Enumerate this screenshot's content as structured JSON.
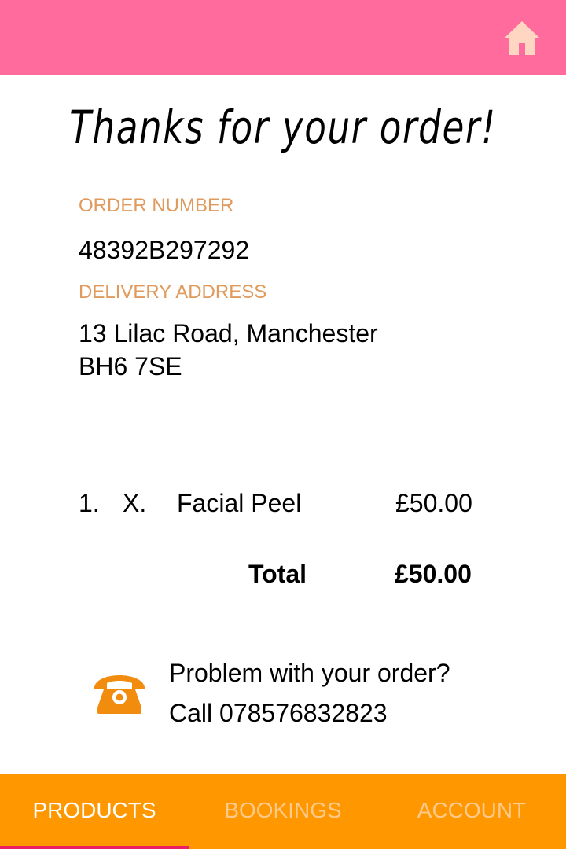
{
  "colors": {
    "header_bg": "#ff6b9d",
    "home_icon": "#ffd6c2",
    "label": "#e09a5c",
    "phone_icon": "#f28c0f",
    "nav_bg": "#ff9800",
    "nav_active_text": "#ffffff",
    "nav_inactive_text": "#ffc98a",
    "nav_indicator": "#e91e63"
  },
  "header": {
    "home_icon": "home-icon"
  },
  "title": "Thanks for your order!",
  "order": {
    "number_label": "ORDER NUMBER",
    "number": "48392B297292",
    "address_label": "DELIVERY ADDRESS",
    "address_line1": "13  Lilac Road, Manchester",
    "address_line2": "BH6 7SE"
  },
  "items": [
    {
      "index": "1.",
      "remove": "X.",
      "name": "Facial Peel",
      "price": "£50.00"
    }
  ],
  "total": {
    "label": "Total",
    "value": "£50.00"
  },
  "help": {
    "icon": "telephone-icon",
    "line1": "Problem with your order?",
    "line2": "Call 078576832823"
  },
  "nav": {
    "active": "PRODUCTS",
    "items": [
      {
        "label": "PRODUCTS"
      },
      {
        "label": "BOOKINGS"
      },
      {
        "label": "ACCOUNT"
      }
    ]
  }
}
